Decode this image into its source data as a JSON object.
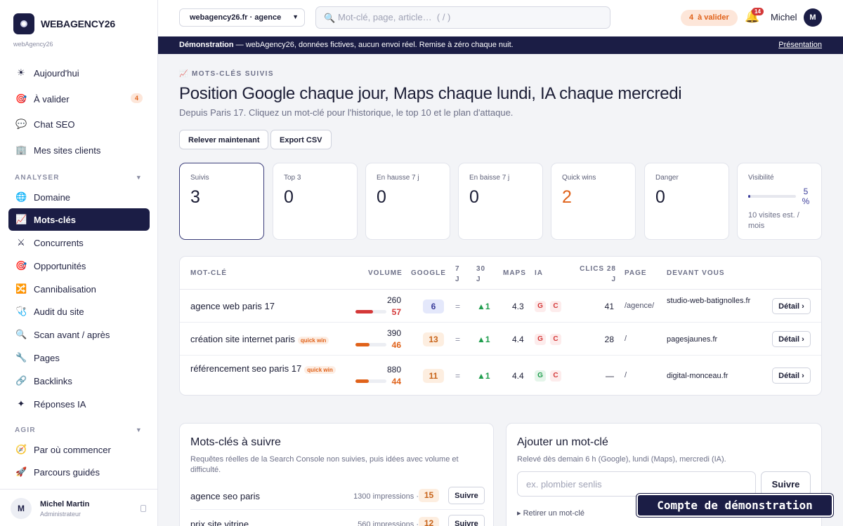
{
  "brand": {
    "name": "WEBAGENCY26",
    "sub": "webAgency26"
  },
  "sidebar": {
    "top_items": [
      {
        "label": "Aujourd'hui",
        "icon": "sun-icon",
        "glyph": "☀"
      },
      {
        "label": "À valider",
        "icon": "target-icon",
        "glyph": "🎯",
        "badge": "4"
      },
      {
        "label": "Chat SEO",
        "icon": "chat-icon",
        "glyph": "💬"
      },
      {
        "label": "Mes sites clients",
        "icon": "building-icon",
        "glyph": "🏢"
      }
    ],
    "section_analyser": "ANALYSER",
    "analyser_items": [
      {
        "label": "Domaine",
        "icon": "globe-icon",
        "glyph": "🌐"
      },
      {
        "label": "Mots-clés",
        "icon": "chart-up-icon",
        "glyph": "📈"
      },
      {
        "label": "Concurrents",
        "icon": "swords-icon",
        "glyph": "⚔"
      },
      {
        "label": "Opportunités",
        "icon": "target-icon",
        "glyph": "🎯"
      },
      {
        "label": "Cannibalisation",
        "icon": "shuffle-icon",
        "glyph": "🔀"
      },
      {
        "label": "Audit du site",
        "icon": "stethoscope-icon",
        "glyph": "🩺"
      },
      {
        "label": "Scan avant / après",
        "icon": "magnifier-icon",
        "glyph": "🔍"
      },
      {
        "label": "Pages",
        "icon": "wrench-icon",
        "glyph": "🔧"
      },
      {
        "label": "Backlinks",
        "icon": "link-icon",
        "glyph": "🔗"
      },
      {
        "label": "Réponses IA",
        "icon": "sparkle-icon",
        "glyph": "✦"
      }
    ],
    "section_agir": "AGIR",
    "agir_items": [
      {
        "label": "Par où commencer",
        "icon": "compass-icon",
        "glyph": "🧭"
      },
      {
        "label": "Parcours guidés",
        "icon": "rocket-icon",
        "glyph": "🚀"
      }
    ],
    "user": {
      "initial": "M",
      "name": "Michel Martin",
      "role": "Administrateur"
    }
  },
  "topbar": {
    "site_select": "webagency26.fr · agence",
    "search_placeholder": "Mot-clé, page, article…  ( / )",
    "to_validate_count": "4",
    "to_validate_label": "à valider",
    "bell_count": "14",
    "user_name": "Michel",
    "user_initial": "M"
  },
  "demo_bar": {
    "bold": "Démonstration",
    "text": " — webAgency26, données fictives, aucun envoi réel. Remise à zéro chaque nuit.",
    "link": "Présentation"
  },
  "page": {
    "eyebrow": "📈 MOTS-CLÉS SUIVIS",
    "title": "Position Google chaque jour, Maps chaque lundi, IA chaque mercredi",
    "subtitle": "Depuis Paris 17. Cliquez un mot-clé pour l'historique, le top 10 et le plan d'attaque.",
    "btn_refresh": "Relever maintenant",
    "btn_export": "Export CSV"
  },
  "kpis": [
    {
      "label": "Suivis",
      "value": "3"
    },
    {
      "label": "Top 3",
      "value": "0"
    },
    {
      "label": "En hausse 7 j",
      "value": "0"
    },
    {
      "label": "En baisse 7 j",
      "value": "0"
    },
    {
      "label": "Quick wins",
      "value": "2"
    },
    {
      "label": "Danger",
      "value": "0"
    }
  ],
  "visibility": {
    "label": "Visibilité",
    "pct": "5 %",
    "fraction": 0.05,
    "note": "10 visites est. / mois"
  },
  "table": {
    "headers": {
      "keyword": "MOT-CLÉ",
      "volume": "VOLUME",
      "google": "GOOGLE",
      "d7": "7 J",
      "d30": "30 J",
      "maps": "MAPS",
      "ia": "IA",
      "clicks": "CLICS 28 J",
      "page": "PAGE",
      "ahead": "DEVANT VOUS"
    },
    "quick_label": "quick win",
    "detail_label": "Détail ›",
    "rows": [
      {
        "keyword": "agence web paris 17",
        "quick": false,
        "volume": "260",
        "difficulty": "57",
        "difficulty_fraction": 0.57,
        "google": "6",
        "d7": "=",
        "d30": "▲1",
        "maps": "4.3",
        "ia1": "G",
        "ia2": "C",
        "ia_first_green": false,
        "clicks": "41",
        "page": "/agence/",
        "ahead": "studio-web-batignolles.fr"
      },
      {
        "keyword": "création site internet paris",
        "quick": true,
        "volume": "390",
        "difficulty": "46",
        "difficulty_fraction": 0.46,
        "google": "13",
        "d7": "=",
        "d30": "▲1",
        "maps": "4.4",
        "ia1": "G",
        "ia2": "C",
        "ia_first_green": false,
        "clicks": "28",
        "page": "/",
        "ahead": "pagesjaunes.fr"
      },
      {
        "keyword": "référencement seo paris 17",
        "quick": true,
        "volume": "880",
        "difficulty": "44",
        "difficulty_fraction": 0.44,
        "google": "11",
        "d7": "=",
        "d30": "▲1",
        "maps": "4.4",
        "ia1": "G",
        "ia2": "C",
        "ia_first_green": true,
        "clicks": "—",
        "page": "/",
        "ahead": "digital-monceau.fr"
      }
    ]
  },
  "to_follow": {
    "title": "Mots-clés à suivre",
    "desc": "Requêtes réelles de la Search Console non suivies, puis idées avec volume et difficulté.",
    "follow_label": "Suivre",
    "items": [
      {
        "keyword": "agence seo paris",
        "impressions": "1300 impressions ·",
        "position": "15"
      },
      {
        "keyword": "prix site vitrine",
        "impressions": "560 impressions ·",
        "position": "12"
      }
    ]
  },
  "add_keyword": {
    "title": "Ajouter un mot-clé",
    "desc": "Relevé dès demain 6 h (Google), lundi (Maps), mercredi (IA).",
    "placeholder": "ex. plombier senlis",
    "button": "Suivre",
    "remove": "▸  Retirer un mot-clé"
  },
  "demo_toast": "Compte de démonstration",
  "colors": {
    "accent": "#1b1d45",
    "orange": "#e0621a",
    "green": "#1f9d4d",
    "red": "#d43838"
  }
}
